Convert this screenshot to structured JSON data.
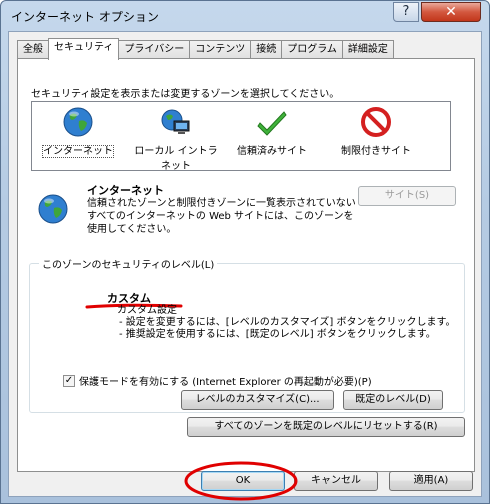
{
  "window": {
    "title": "インターネット オプション",
    "help_label": "?",
    "close_label": "✕"
  },
  "tabs": [
    {
      "label": "全般",
      "active": false
    },
    {
      "label": "セキュリティ",
      "active": true
    },
    {
      "label": "プライバシー",
      "active": false
    },
    {
      "label": "コンテンツ",
      "active": false
    },
    {
      "label": "接続",
      "active": false
    },
    {
      "label": "プログラム",
      "active": false
    },
    {
      "label": "詳細設定",
      "active": false
    }
  ],
  "security": {
    "zone_instruction": "セキュリティ設定を表示または変更するゾーンを選択してください。",
    "zones": [
      {
        "label": "インターネット",
        "icon": "globe-icon",
        "selected": true
      },
      {
        "label": "ローカル イントラネット",
        "icon": "intranet-icon",
        "selected": false
      },
      {
        "label": "信頼済みサイト",
        "icon": "checkmark-icon",
        "selected": false
      },
      {
        "label": "制限付きサイト",
        "icon": "restricted-icon",
        "selected": false
      }
    ],
    "selected_zone": {
      "title": "インターネット",
      "description": "信頼されたゾーンと制限付きゾーンに一覧表示されていないすべてのインターネットの Web サイトには、このゾーンを使用してください。",
      "sites_button": "サイト(S)"
    },
    "level_group": {
      "legend": "このゾーンのセキュリティのレベル(L)",
      "custom_title": "カスタム",
      "custom_lines": [
        "カスタム設定",
        "- 設定を変更するには、[レベルのカスタマイズ] ボタンをクリックします。",
        "- 推奨設定を使用するには、[既定のレベル] ボタンをクリックします。"
      ],
      "protected_mode": "保護モードを有効にする (Internet Explorer の再起動が必要)(P)",
      "protected_mode_checked": true,
      "customize_button": "レベルのカスタマイズ(C)...",
      "default_level_button": "既定のレベル(D)"
    },
    "reset_all_button": "すべてのゾーンを既定のレベルにリセットする(R)"
  },
  "footer": {
    "ok": "OK",
    "cancel": "キャンセル",
    "apply": "適用(A)"
  },
  "colors": {
    "annotation_red": "#e00000"
  }
}
